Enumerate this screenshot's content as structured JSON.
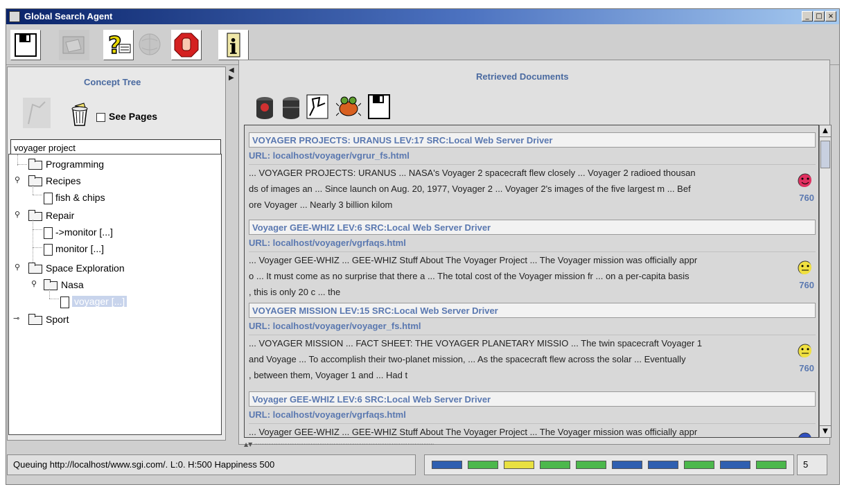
{
  "window": {
    "title": "Global Search Agent",
    "minimize": "_",
    "maximize": "□",
    "close": "×"
  },
  "toolbar": {
    "buttons": [
      "save-icon",
      "open-folder-icon",
      "help-icon",
      "globe-icon",
      "stop-icon",
      "info-icon"
    ],
    "info_glyph": "i"
  },
  "left": {
    "title": "Concept Tree",
    "see_pages_label": "See Pages",
    "search_value": "voyager project",
    "tree": [
      {
        "label": "Programming"
      },
      {
        "label": "Recipes"
      },
      {
        "label": "fish & chips"
      },
      {
        "label": "Repair"
      },
      {
        "label": "->monitor [...]"
      },
      {
        "label": "monitor [...]"
      },
      {
        "label": "Space Exploration"
      },
      {
        "label": "Nasa"
      },
      {
        "label": "voyager [...]"
      },
      {
        "label": "Sport"
      }
    ]
  },
  "right": {
    "title": "Retrieved Documents",
    "tools": [
      "database-red-icon",
      "database-icon",
      "map-icon",
      "bug-icon",
      "save-icon"
    ],
    "documents": [
      {
        "header": "VOYAGER PROJECTS: URANUS LEV:17 SRC:Local Web Server Driver",
        "url": "URL: localhost/voyager/vgrur_fs.html",
        "line1": "... VOYAGER PROJECTS: URANUS ... NASA's Voyager 2 spacecraft flew closely ... Voyager 2 radioed thousan",
        "line2": "ds of images an ... Since launch on Aug. 20, 1977, Voyager 2 ... Voyager 2's images of the five largest m ... Bef",
        "line3": "ore Voyager ... Nearly 3 billion kilom",
        "score": "760",
        "face_color": "#e03060"
      },
      {
        "header": "Voyager GEE-WHIZ LEV:6 SRC:Local Web Server Driver",
        "url": "URL: localhost/voyager/vgrfaqs.html",
        "line1": "... Voyager GEE-WHIZ ... GEE-WHIZ Stuff About The Voyager Project ... The Voyager mission was officially appr",
        "line2": "o ... It must come as no surprise that there a ... The total cost of the Voyager mission fr ... on a per-capita basis",
        "line3": ", this is only 20 c ... the",
        "score": "760",
        "face_color": "#f0e040"
      },
      {
        "header": "VOYAGER MISSION LEV:15 SRC:Local Web Server Driver",
        "url": "URL: localhost/voyager/voyager_fs.html",
        "line1": "... VOYAGER MISSION ... FACT SHEET: THE VOYAGER PLANETARY MISSIO ... The twin spacecraft Voyager 1",
        "line2": "and Voyage ... To accomplish their two-planet mission, ... As the spacecraft flew across the solar ... Eventually",
        "line3": ", between them, Voyager 1 and ... Had t",
        "score": "760",
        "face_color": "#f0e040"
      },
      {
        "header": "Voyager GEE-WHIZ LEV:6 SRC:Local Web Server Driver",
        "url": "URL: localhost/voyager/vgrfaqs.html",
        "line1": "... Voyager GEE-WHIZ ... GEE-WHIZ Stuff About The Voyager Project ... The Voyager mission was officially appr",
        "line2": "",
        "line3": "",
        "score": "",
        "face_color": "#3050c0"
      }
    ]
  },
  "status": {
    "text": "Queuing http://localhost/www.sgi.com/. L:0. H:500 Happiness 500",
    "count": "5",
    "bar_colors": [
      "#2f5fb0",
      "#4cb84c",
      "#e8e040",
      "#4cb84c",
      "#4cb84c",
      "#2f5fb0",
      "#2f5fb0",
      "#4cb84c",
      "#2f5fb0",
      "#4cb84c"
    ]
  }
}
